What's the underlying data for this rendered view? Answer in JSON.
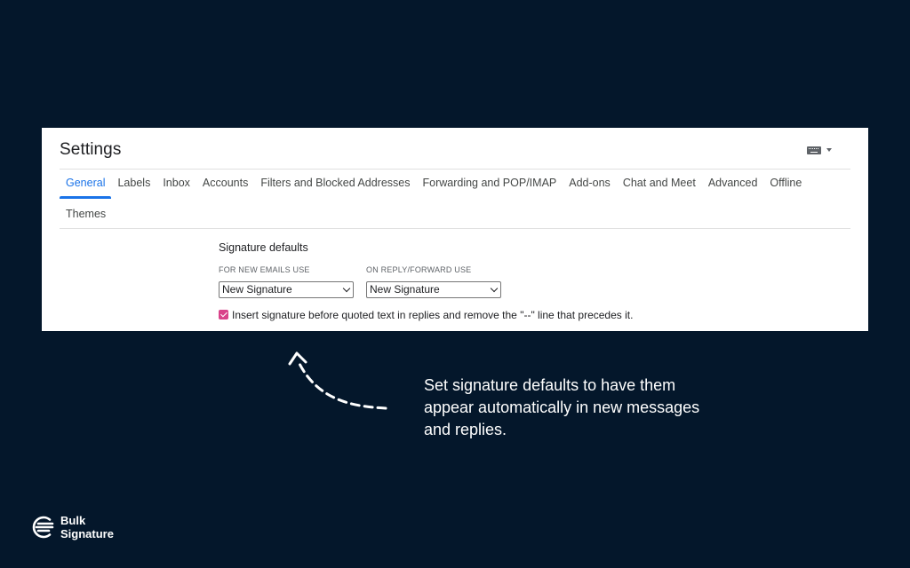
{
  "settings": {
    "title": "Settings"
  },
  "tabs": [
    {
      "label": "General",
      "active": true
    },
    {
      "label": "Labels"
    },
    {
      "label": "Inbox"
    },
    {
      "label": "Accounts"
    },
    {
      "label": "Filters and Blocked Addresses"
    },
    {
      "label": "Forwarding and POP/IMAP"
    },
    {
      "label": "Add-ons"
    },
    {
      "label": "Chat and Meet"
    },
    {
      "label": "Advanced"
    },
    {
      "label": "Offline"
    },
    {
      "label": "Themes"
    }
  ],
  "signature": {
    "heading": "Signature defaults",
    "new_emails_label": "FOR NEW EMAILS USE",
    "new_emails_value": "New Signature",
    "reply_label": "ON REPLY/FORWARD USE",
    "reply_value": "New Signature",
    "insert_before_label": "Insert signature before quoted text in replies and remove the \"--\" line that precedes it.",
    "insert_before_checked": true
  },
  "caption": {
    "line1": "Set signature defaults to have them",
    "line2": "appear automatically in new messages",
    "line3": "and replies."
  },
  "brand": {
    "line1": "Bulk",
    "line2": "Signature"
  },
  "colors": {
    "background": "#04172b",
    "accent": "#1a73e8",
    "checkbox": "#d9428a"
  },
  "icons": {
    "keyboard": "keyboard-icon",
    "dropdown": "chevron-down-icon"
  }
}
